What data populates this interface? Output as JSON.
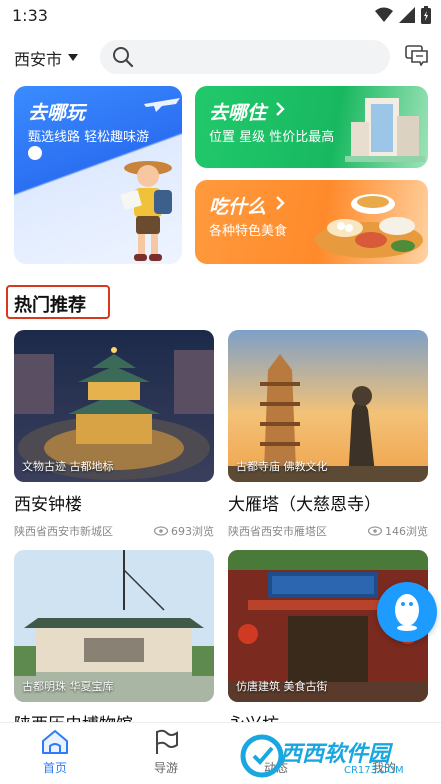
{
  "status_bar": {
    "time": "1:33"
  },
  "header": {
    "city": "西安市",
    "search_placeholder": ""
  },
  "feature_cards": {
    "go": {
      "title": "去哪玩",
      "subtitle": "甄选线路 轻松趣味游"
    },
    "stay": {
      "title": "去哪住",
      "subtitle": "位置 星级 性价比最高"
    },
    "eat": {
      "title": "吃什么",
      "subtitle": "各种特色美食"
    }
  },
  "section": {
    "title": "热门推荐"
  },
  "pois": [
    {
      "tag": "文物古迹 古都地标",
      "name": "西安钟楼",
      "location": "陕西省西安市新城区",
      "views": "693浏览"
    },
    {
      "tag": "古都寺庙 佛教文化",
      "name": "大雁塔（大慈恩寺）",
      "location": "陕西省西安市雁塔区",
      "views": "146浏览"
    },
    {
      "tag": "古都明珠 华夏宝库",
      "name": "陕西历史博物馆",
      "location": "",
      "views": ""
    },
    {
      "tag": "仿唐建筑 美食古街",
      "name": "永兴坊",
      "location": "",
      "views": ""
    }
  ],
  "tabs": [
    {
      "label": "首页"
    },
    {
      "label": "导游"
    },
    {
      "label": "动态"
    },
    {
      "label": "我的"
    }
  ],
  "watermark": {
    "text": "西西软件园",
    "url_text": "CR173.COM"
  },
  "colors": {
    "accent": "#2f7bf5",
    "section_highlight": "#d9371e",
    "card_blue": "#3b8cff",
    "card_green": "#21c96b",
    "card_orange": "#ff9a3d"
  }
}
